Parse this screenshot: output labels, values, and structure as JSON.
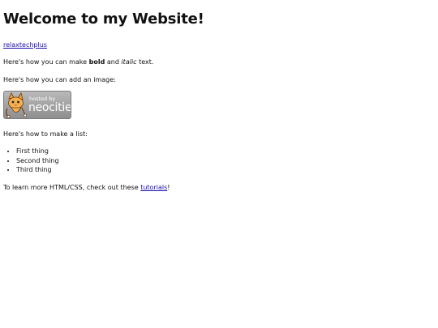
{
  "heading": "Welcome to my Website!",
  "link": "relaxtechplus",
  "formatting": {
    "before": "Here's how you can make ",
    "bold": "bold",
    "middle": " and ",
    "italic": "italic",
    "after": " text."
  },
  "image_intro": "Here's how you can add an image:",
  "badge": {
    "hosted_by": "hosted by",
    "brand": "neocities",
    "icon": "neocities-cat-icon"
  },
  "list_intro": "Here's how to make a list:",
  "list_items": [
    "First thing",
    "Second thing",
    "Third thing"
  ],
  "footer": {
    "before": "To learn more HTML/CSS, check out these ",
    "link": "tutorials",
    "after": "!"
  },
  "colors": {
    "link": "#1a0dab",
    "badge": "#a8a8a8",
    "cat": "#f2a13b"
  }
}
